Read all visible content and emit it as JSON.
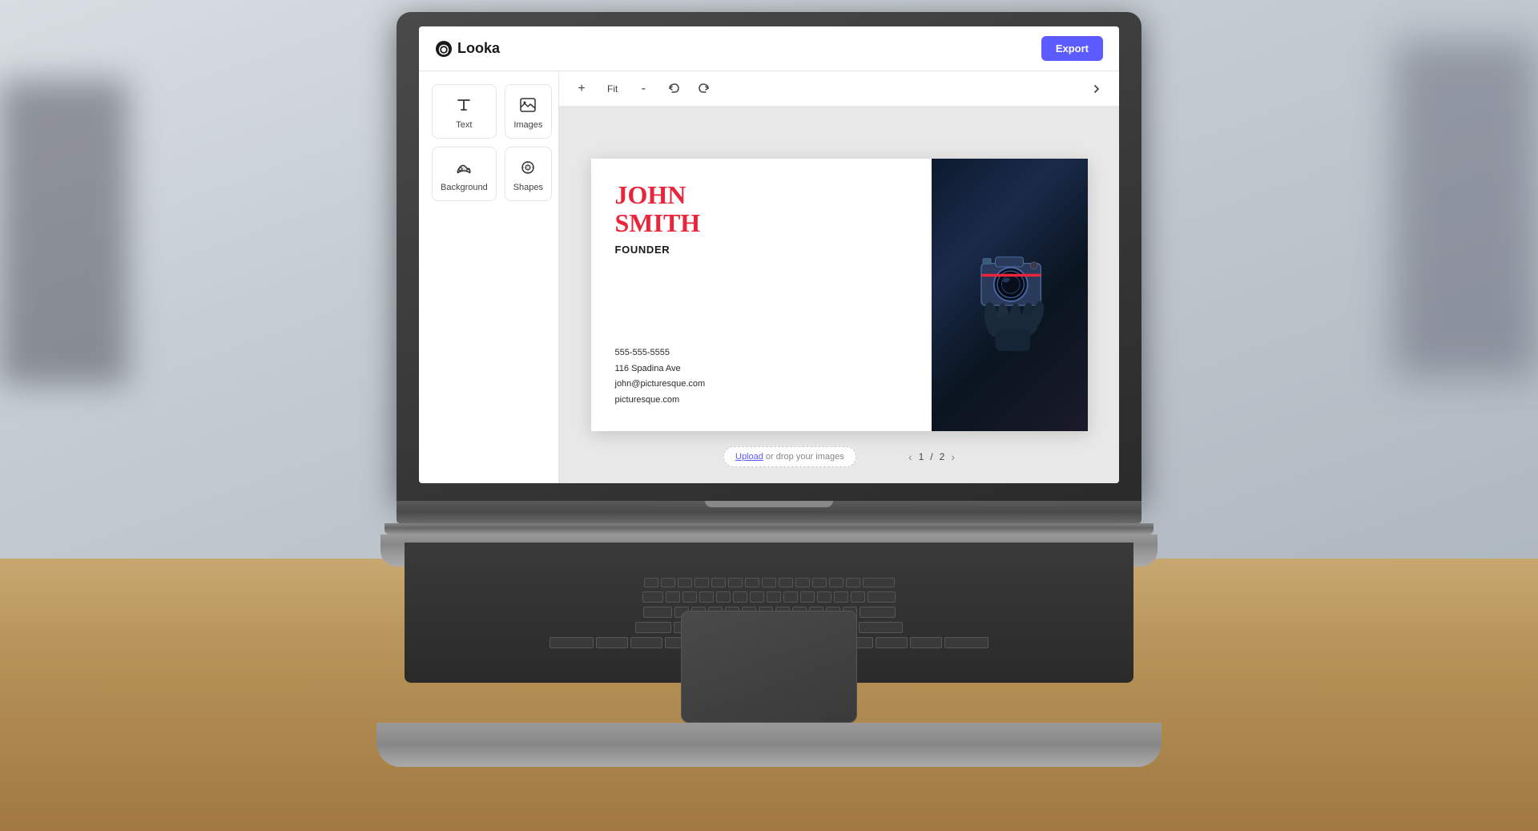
{
  "app": {
    "title": "Looka",
    "export_label": "Export"
  },
  "toolbar": {
    "zoom_in": "+",
    "fit_label": "Fit",
    "zoom_out": "-",
    "undo_icon": "↺",
    "redo_icon": "↻",
    "chevron_right": "›"
  },
  "sidebar": {
    "items": [
      {
        "id": "text",
        "label": "Text",
        "icon": "T"
      },
      {
        "id": "images",
        "label": "Images",
        "icon": "⊞"
      },
      {
        "id": "background",
        "label": "Background",
        "icon": "🪣"
      },
      {
        "id": "shapes",
        "label": "Shapes",
        "icon": "◎"
      }
    ]
  },
  "business_card": {
    "name_line1": "JOHN",
    "name_line2": "SMITH",
    "title": "FOUNDER",
    "phone": "555-555-5555",
    "address": "116 Spadina Ave",
    "email": "john@picturesque.com",
    "website": "picturesque.com",
    "name_color": "#e8253a",
    "background_color": "#ffffff"
  },
  "canvas": {
    "upload_text_prefix": "Upload",
    "upload_text_suffix": " or drop your images",
    "pagination_current": "1",
    "pagination_total": "2",
    "pagination_separator": "/"
  }
}
